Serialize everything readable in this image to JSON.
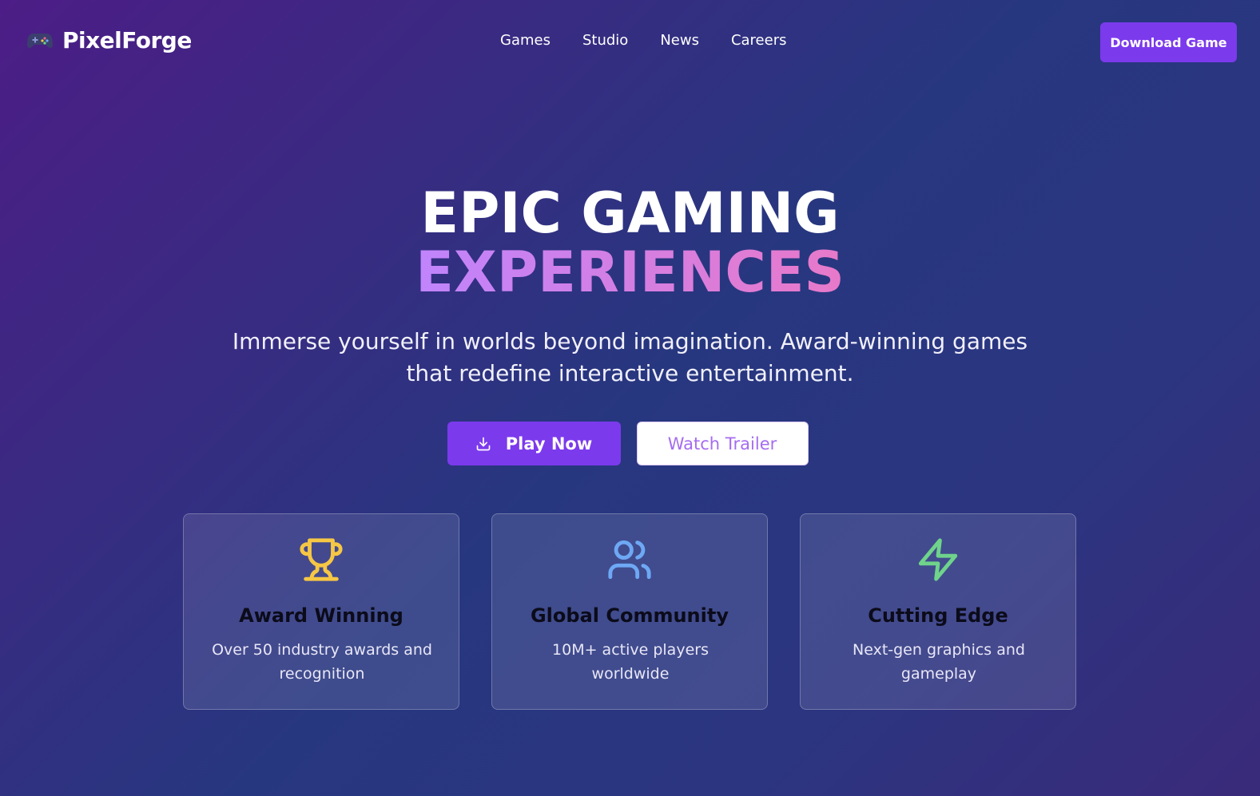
{
  "brand": {
    "name": "PixelForge",
    "icon": "gamepad-icon"
  },
  "nav": {
    "links": [
      "Games",
      "Studio",
      "News",
      "Careers"
    ],
    "cta_label": "Download Game"
  },
  "hero": {
    "title_line1": "EPIC GAMING",
    "title_line2": "EXPERIENCES",
    "subtitle": "Immerse yourself in worlds beyond imagination. Award-winning games that redefine interactive entertainment.",
    "play_label": "Play Now",
    "play_icon": "download-icon",
    "trailer_label": "Watch Trailer"
  },
  "features": [
    {
      "icon": "trophy-icon",
      "icon_color": "#f6c744",
      "title": "Award Winning",
      "description": "Over 50 industry awards and recognition"
    },
    {
      "icon": "users-icon",
      "icon_color": "#6ea8f5",
      "title": "Global Community",
      "description": "10M+ active players worldwide"
    },
    {
      "icon": "zap-icon",
      "icon_color": "#6fd38b",
      "title": "Cutting Edge",
      "description": "Next-gen graphics and gameplay"
    }
  ],
  "colors": {
    "accent": "#7c3aed",
    "gradient_text_start": "#c084fc",
    "gradient_text_end": "#e879c9"
  }
}
